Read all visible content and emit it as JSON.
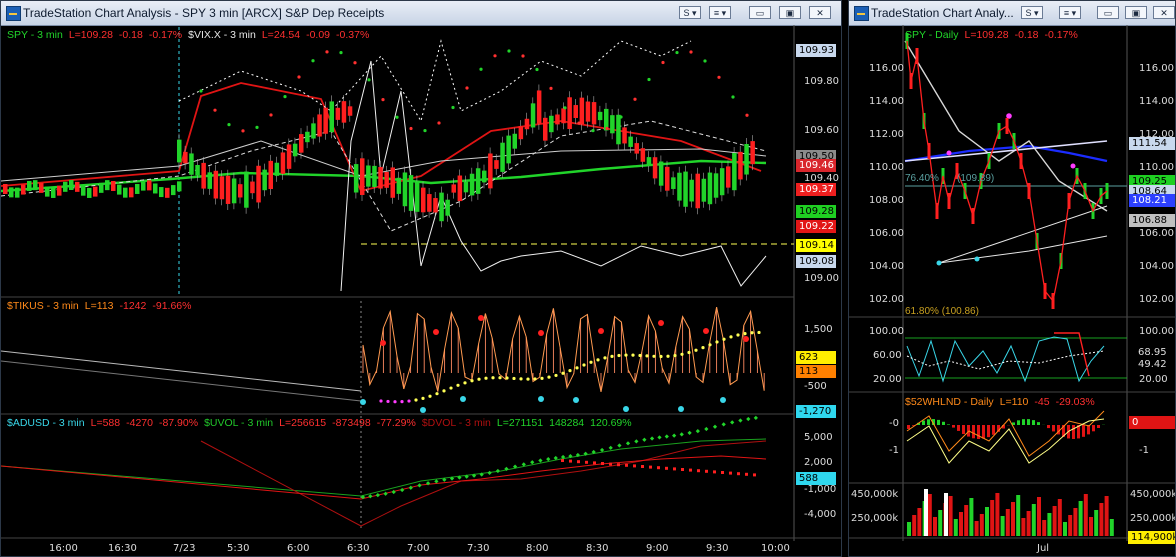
{
  "colors": {
    "green": "#21d42a",
    "red": "#ff2020",
    "cyan": "#39d6e8",
    "orange": "#ff8a1a",
    "white": "#e6e6e6",
    "yellow": "#ffff55",
    "magenta": "#ff3cff",
    "blue": "#2336ff"
  },
  "left_window": {
    "title": "TradeStation Chart Analysis - SPY 3 min [ARCX] S&P Dep Receipts",
    "buttons": {
      "dd1": "S ▾",
      "dd2": "≡ ▾",
      "min": "▭",
      "max": "▣",
      "close": "✕"
    },
    "main": {
      "spy": {
        "name": "SPY - 3 min",
        "last": "L=109.28",
        "chg": "-0.18",
        "pct": "-0.17%"
      },
      "vix": {
        "name": "$VIX.X - 3 min",
        "last": "L=24.54",
        "chg": "-0.09",
        "pct": "-0.37%"
      },
      "ticks": [
        "109.80",
        "109.60",
        "109.40",
        "109.00"
      ],
      "badges": [
        {
          "t": "109.93",
          "bg": "#c9d9ee",
          "fg": "#000"
        },
        {
          "t": "109.50",
          "bg": "#8b8b8b",
          "fg": "#000"
        },
        {
          "t": "109.46",
          "bg": "#d9262c",
          "fg": "#fff"
        },
        {
          "t": "109.37",
          "bg": "#ef1f1f",
          "fg": "#fff"
        },
        {
          "t": "109.28",
          "bg": "#1fd022",
          "fg": "#000"
        },
        {
          "t": "109.22",
          "bg": "#e21616",
          "fg": "#fff"
        },
        {
          "t": "109.14",
          "bg": "#ffff00",
          "fg": "#000"
        },
        {
          "t": "109.08",
          "bg": "#c9d9ee",
          "fg": "#000"
        }
      ]
    },
    "tikus": {
      "header": {
        "name": "$TIKUS - 3 min",
        "last": "L=113",
        "chg": "-1242",
        "pct": "-91.66%"
      },
      "ticks": [
        "1,500",
        "-500"
      ],
      "badges": [
        {
          "t": "623",
          "bg": "#ffee00",
          "fg": "#000"
        },
        {
          "t": "113",
          "bg": "#ff8000",
          "fg": "#000"
        },
        {
          "t": "-1,270",
          "bg": "#2fd7ee",
          "fg": "#000"
        }
      ]
    },
    "adusd": {
      "adusd": {
        "name": "$ADUSD - 3 min",
        "last": "L=588",
        "chg": "-4270",
        "pct": "-87.90%"
      },
      "uvol": {
        "name": "$UVOL - 3 min",
        "last": "L=256615",
        "chg": "-873498",
        "pct": "-77.29%"
      },
      "dvol": {
        "name": "$DVOL - 3 min",
        "last": "L=271151",
        "chg": "148284",
        "pct": "120.69%"
      },
      "ticks": [
        "5,000",
        "2,000",
        "-1,000",
        "-4,000"
      ],
      "badges": [
        {
          "t": "588",
          "bg": "#2fd7ee",
          "fg": "#000"
        }
      ]
    },
    "time_axis": [
      "16:00",
      "16:30",
      "7/23",
      "5:30",
      "6:00",
      "6:30",
      "7:00",
      "7:30",
      "8:00",
      "8:30",
      "9:00",
      "9:30",
      "10:00"
    ]
  },
  "right_window": {
    "title": "TradeStation Chart Analy...",
    "buttons": {
      "dd1": "S ▾",
      "dd2": "≡ ▾",
      "min": "▭",
      "max": "▣",
      "close": "✕"
    },
    "main": {
      "spy": {
        "name": "SPY - Daily",
        "last": "L=109.28",
        "chg": "-0.18",
        "pct": "-0.17%"
      },
      "ticks": [
        "116.00",
        "114.00",
        "112.00",
        "110.00",
        "108.00",
        "106.00",
        "104.00",
        "102.00"
      ],
      "fib1": "76.40%",
      "fib1b": "(109.89)",
      "fib2": "61.80% (100.86)",
      "badges": [
        {
          "t": "111.54",
          "bg": "#c9d9ee",
          "fg": "#000"
        },
        {
          "t": "109.25",
          "bg": "#1fd022",
          "fg": "#000"
        },
        {
          "t": "108.64",
          "bg": "#c9d9ee",
          "fg": "#000"
        },
        {
          "t": "108.21",
          "bg": "#2d40ff",
          "fg": "#fff"
        },
        {
          "t": "106.88",
          "bg": "#c0c0c0",
          "fg": "#000"
        }
      ]
    },
    "stoch": {
      "ticks": [
        "100.00",
        "60.00",
        "20.00"
      ],
      "badges": [
        {
          "t": "68.95",
          "bg": "#000",
          "fg": "#ddd"
        },
        {
          "t": "49.42",
          "bg": "#000",
          "fg": "#ddd"
        }
      ]
    },
    "whlnd": {
      "header": {
        "name": "$52WHLND - Daily",
        "last": "L=110",
        "chg": "-45",
        "pct": "-29.03%"
      },
      "ticks": [
        "-0",
        "-1"
      ],
      "badges": [
        {
          "t": "0",
          "bg": "#e01414",
          "fg": "#fff"
        }
      ]
    },
    "volume": {
      "ticks": [
        "450,000k",
        "250,000k"
      ],
      "badges": [
        {
          "t": "114,900k",
          "bg": "#ffee00",
          "fg": "#000"
        }
      ]
    },
    "time_axis": [
      "Jul"
    ]
  }
}
